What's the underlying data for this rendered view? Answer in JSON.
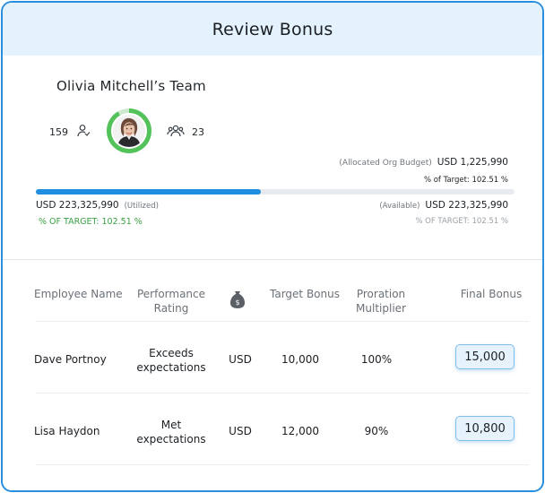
{
  "header": {
    "title": "Review Bonus"
  },
  "team": {
    "name": "Olivia Mitchell’s Team",
    "left_count": "159",
    "right_count": "23"
  },
  "budget": {
    "allocated_label": "(Allocated Org Budget)",
    "allocated_value": "USD 1,225,990",
    "pct_target_top": "% of Target: 102.51 %",
    "utilized_value": "USD 223,325,990",
    "utilized_label": "(Utilized)",
    "utilized_pct": "% OF TARGET: 102.51 %",
    "available_label": "(Available)",
    "available_value": "USD 223,325,990",
    "available_pct": "% OF TARGET: 102.51 %",
    "progress_fraction": 0.47
  },
  "table": {
    "headers": {
      "employee": "Employee Name",
      "rating_line1": "Performance",
      "rating_line2": "Rating",
      "target": "Target Bonus",
      "proration_line1": "Proration",
      "proration_line2": "Multiplier",
      "final": "Final Bonus"
    },
    "rows": [
      {
        "name": "Dave Portnoy",
        "rating_line1": "Exceeds",
        "rating_line2": "expectations",
        "currency": "USD",
        "target": "10,000",
        "proration": "100%",
        "final": "15,000"
      },
      {
        "name": "Lisa Haydon",
        "rating_line1": "Met",
        "rating_line2": "expectations",
        "currency": "USD",
        "target": "12,000",
        "proration": "90%",
        "final": "10,800"
      }
    ]
  },
  "colors": {
    "accent": "#2b8fe0",
    "progress": "#1f8de0",
    "ring": "#53c25a",
    "positive": "#3aa043"
  }
}
